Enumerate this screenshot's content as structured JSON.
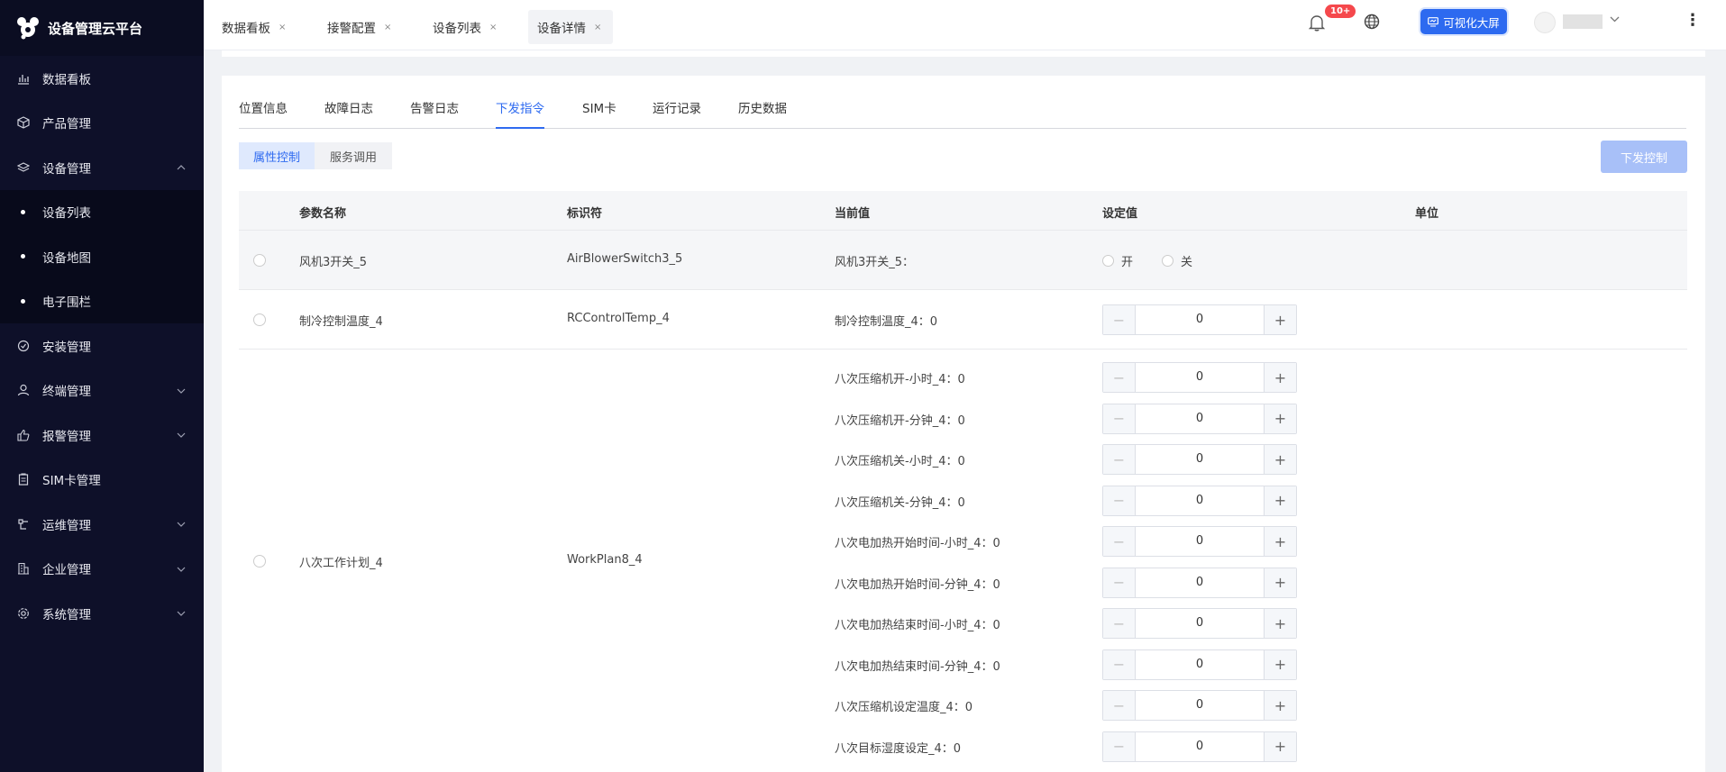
{
  "app": {
    "title": "设备管理云平台"
  },
  "sidebar": {
    "items": [
      {
        "label": "数据看板",
        "icon": "bar-chart-icon",
        "chevron": ""
      },
      {
        "label": "产品管理",
        "icon": "cube-icon",
        "chevron": ""
      },
      {
        "label": "设备管理",
        "icon": "layers-icon",
        "chevron": "up"
      },
      {
        "label": "安装管理",
        "icon": "check-circle-icon",
        "chevron": ""
      },
      {
        "label": "终端管理",
        "icon": "user-icon",
        "chevron": "down"
      },
      {
        "label": "报警管理",
        "icon": "thumb-icon",
        "chevron": "down"
      },
      {
        "label": "SIM卡管理",
        "icon": "clipboard-icon",
        "chevron": ""
      },
      {
        "label": "运维管理",
        "icon": "tool-icon",
        "chevron": "down"
      },
      {
        "label": "企业管理",
        "icon": "building-icon",
        "chevron": "down"
      },
      {
        "label": "系统管理",
        "icon": "gear-icon",
        "chevron": "down"
      }
    ],
    "sub_items": [
      "设备列表",
      "设备地图",
      "电子围栏"
    ]
  },
  "topbar": {
    "tabs": [
      {
        "label": "数据看板",
        "active": false
      },
      {
        "label": "接警配置",
        "active": false
      },
      {
        "label": "设备列表",
        "active": false
      },
      {
        "label": "设备详情",
        "active": true
      }
    ],
    "close_glyph": "×",
    "badge": "10+",
    "big_screen_label": "可视化大屏",
    "user_name": "",
    "chevron": "⌄",
    "more": "⋮"
  },
  "detail": {
    "tabs": [
      "位置信息",
      "故障日志",
      "告警日志",
      "下发指令",
      "SIM卡",
      "运行记录",
      "历史数据"
    ],
    "active_tab": "下发指令",
    "segments": [
      "属性控制",
      "服务调用"
    ],
    "send_button": "下发控制"
  },
  "table": {
    "headers": [
      "参数名称",
      "标识符",
      "当前值",
      "设定值",
      "单位"
    ],
    "rows": [
      {
        "name": "风机3开关_5",
        "id": "AirBlowerSwitch3_5",
        "current": "风机3开关_5：",
        "options": [
          "开",
          "关"
        ]
      },
      {
        "name": "制冷控制温度_4",
        "id": "RCControlTemp_4",
        "current": "制冷控制温度_4：0",
        "value": "0"
      },
      {
        "name": "八次工作计划_4",
        "id": "WorkPlan8_4",
        "subs": [
          {
            "label": "八次压缩机开-小时_4：0",
            "value": "0"
          },
          {
            "label": "八次压缩机开-分钟_4：0",
            "value": "0"
          },
          {
            "label": "八次压缩机关-小时_4：0",
            "value": "0"
          },
          {
            "label": "八次压缩机关-分钟_4：0",
            "value": "0"
          },
          {
            "label": "八次电加热开始时间-小时_4：0",
            "value": "0"
          },
          {
            "label": "八次电加热开始时间-分钟_4：0",
            "value": "0"
          },
          {
            "label": "八次电加热结束时间-小时_4：0",
            "value": "0"
          },
          {
            "label": "八次电加热结束时间-分钟_4：0",
            "value": "0"
          },
          {
            "label": "八次压缩机设定温度_4：0",
            "value": "0"
          },
          {
            "label": "八次目标湿度设定_4：0",
            "value": "0"
          }
        ]
      }
    ],
    "minus": "−",
    "plus": "+"
  }
}
